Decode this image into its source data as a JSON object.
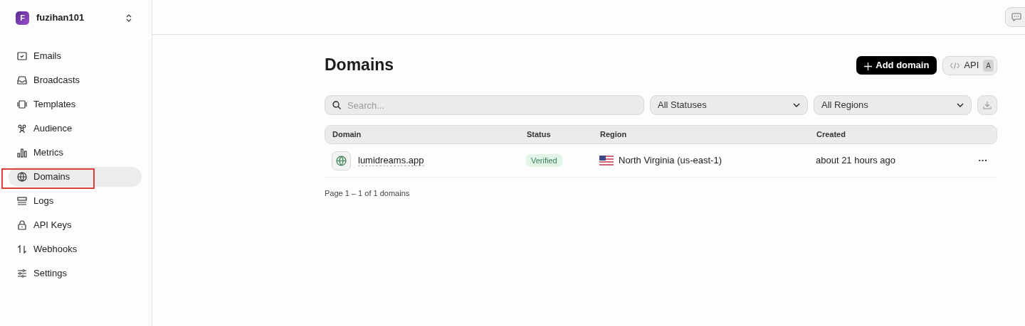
{
  "team": {
    "initial": "F",
    "name": "fuzihan101"
  },
  "nav": [
    {
      "label": "Emails",
      "selected": false
    },
    {
      "label": "Broadcasts",
      "selected": false
    },
    {
      "label": "Templates",
      "selected": false
    },
    {
      "label": "Audience",
      "selected": false
    },
    {
      "label": "Metrics",
      "selected": false
    },
    {
      "label": "Domains",
      "selected": true
    },
    {
      "label": "Logs",
      "selected": false
    },
    {
      "label": "API Keys",
      "selected": false
    },
    {
      "label": "Webhooks",
      "selected": false
    },
    {
      "label": "Settings",
      "selected": false
    }
  ],
  "page": {
    "title": "Domains",
    "add_button": "Add domain",
    "api_button": "API",
    "api_shortcut": "A"
  },
  "filters": {
    "search": {
      "placeholder": "Search..."
    },
    "status": "All Statuses",
    "region": "All Regions"
  },
  "table": {
    "columns": [
      "Domain",
      "Status",
      "Region",
      "Created"
    ],
    "rows": [
      {
        "domain": "lumidreams.app",
        "status": "Verified",
        "region": "North Virginia (us-east-1)",
        "created": "about 21 hours ago",
        "more": "···"
      }
    ]
  },
  "pagination": "Page 1 – 1 of 1 domains"
}
